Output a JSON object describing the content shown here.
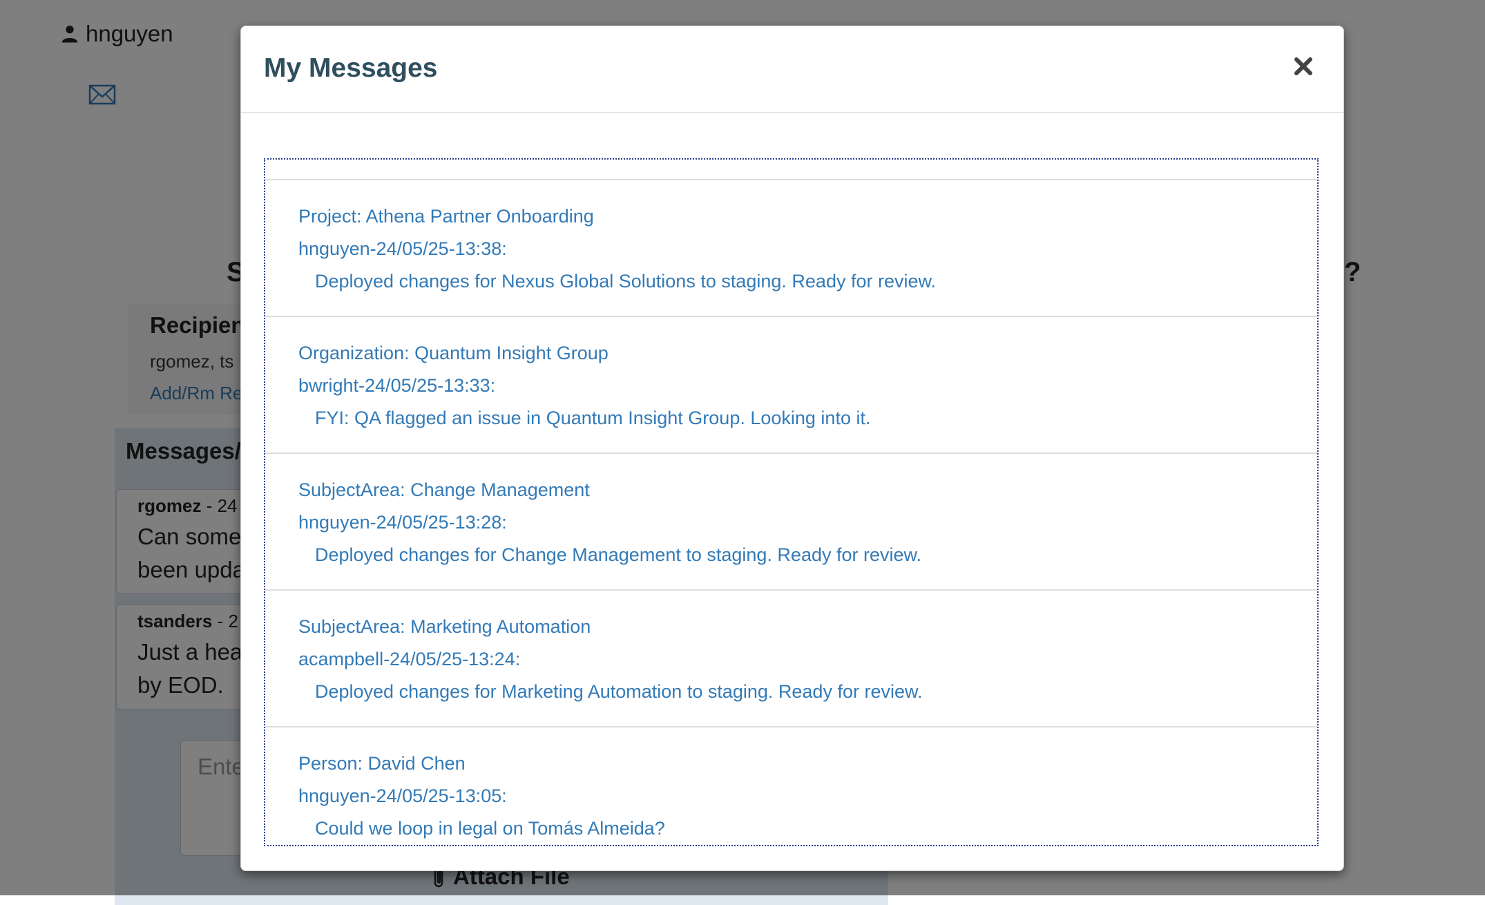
{
  "header": {
    "username": "hnguyen"
  },
  "background": {
    "heading_left": "S",
    "heading_right": "?",
    "recipients": {
      "title": "Recipient",
      "names": "rgomez, ts",
      "link": "Add/Rm Re"
    },
    "messages_panel": {
      "title": "Messages/N",
      "chats": [
        {
          "author": "rgomez",
          "meta": " - 24",
          "text": "Can someo\nbeen upda"
        },
        {
          "author": "tsanders",
          "meta": " - 2",
          "text": "Just a hea\nby EOD."
        }
      ],
      "input_placeholder": "Ente",
      "attach_label": "Attach File"
    }
  },
  "modal": {
    "title": "My Messages",
    "items": [
      {
        "context": "Project: Athena Partner Onboarding",
        "meta": "hnguyen-24/05/25-13:38:",
        "body": "Deployed changes for Nexus Global Solutions to staging. Ready for review."
      },
      {
        "context": "Organization: Quantum Insight Group",
        "meta": "bwright-24/05/25-13:33:",
        "body": "FYI: QA flagged an issue in Quantum Insight Group. Looking into it."
      },
      {
        "context": "SubjectArea: Change Management",
        "meta": "hnguyen-24/05/25-13:28:",
        "body": "Deployed changes for Change Management to staging. Ready for review."
      },
      {
        "context": "SubjectArea: Marketing Automation",
        "meta": "acampbell-24/05/25-13:24:",
        "body": "Deployed changes for Marketing Automation to staging. Ready for review."
      },
      {
        "context": "Person: David Chen",
        "meta": "hnguyen-24/05/25-13:05:",
        "body": "Could we loop in legal on Tomás Almeida?"
      }
    ]
  },
  "icons": {
    "user": "user-icon",
    "mail": "envelope-icon",
    "close": "close-icon",
    "attach": "paperclip-icon"
  },
  "colors": {
    "link": "#337ab7",
    "modal_title": "#2f4f5f",
    "overlay": "rgba(0,0,0,0.5)"
  }
}
